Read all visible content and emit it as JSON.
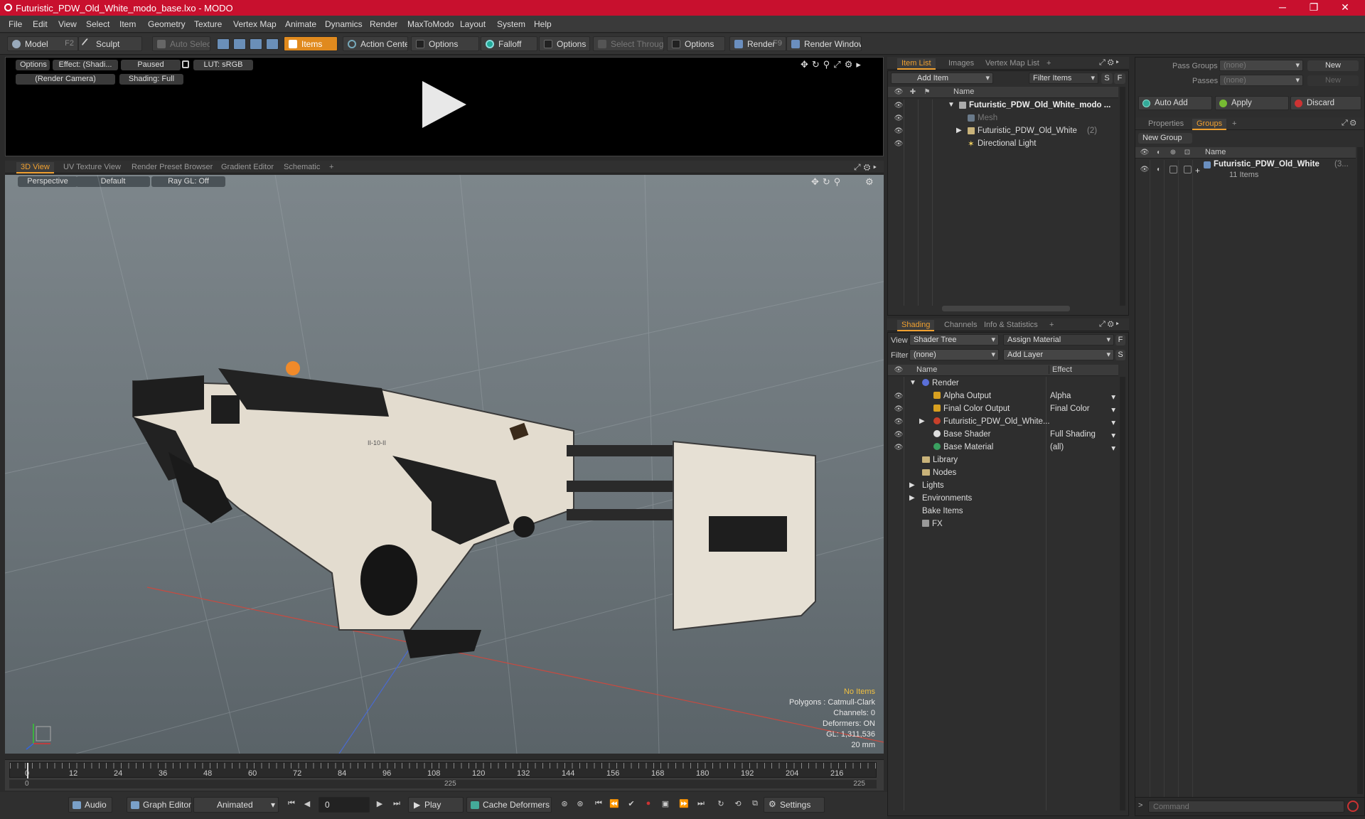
{
  "window": {
    "title": "Futuristic_PDW_Old_White_modo_base.lxo - MODO",
    "minimize": "─",
    "restore": "❐",
    "close": "✕"
  },
  "menu": [
    "File",
    "Edit",
    "View",
    "Select",
    "Item",
    "Geometry",
    "Texture",
    "Vertex Map",
    "Animate",
    "Dynamics",
    "Render",
    "MaxToModo",
    "Layout",
    "System",
    "Help"
  ],
  "toolbar": {
    "model": "Model",
    "model_key": "F2",
    "sculpt": "Sculpt",
    "auto_select": "Auto Select",
    "items": "Items",
    "action_center": "Action Center",
    "options1": "Options",
    "falloff": "Falloff",
    "options2": "Options",
    "select_through": "Select Through",
    "options3": "Options",
    "render": "Render",
    "render_key": "F9",
    "render_window": "Render Window"
  },
  "preview": {
    "options": "Options",
    "effect": "Effect: (Shadi...",
    "paused": "Paused",
    "lut": "LUT: sRGB",
    "camera": "(Render Camera)",
    "shading": "Shading: Full"
  },
  "viewport_tabs": [
    "3D View",
    "UV Texture View",
    "Render Preset Browser",
    "Gradient Editor",
    "Schematic",
    "+"
  ],
  "viewport": {
    "perspective": "Perspective",
    "default": "Default",
    "raygl": "Ray GL: Off",
    "hud": {
      "no_items": "No Items",
      "polygons": "Polygons : Catmull-Clark",
      "channels": "Channels: 0",
      "deformers": "Deformers: ON",
      "gl": "GL: 1,311,536",
      "scale": "20 mm"
    },
    "model_label": "II-10-II"
  },
  "timeline": {
    "ticks": [
      "0",
      "12",
      "24",
      "36",
      "48",
      "60",
      "72",
      "84",
      "96",
      "108",
      "120",
      "132",
      "144",
      "156",
      "168",
      "180",
      "192",
      "204",
      "216"
    ],
    "start": "0",
    "mid": "225",
    "end": "225"
  },
  "bottombar": {
    "audio": "Audio",
    "graph_editor": "Graph Editor",
    "animated": "Animated",
    "frame": "0",
    "play": "Play",
    "cache_deformers": "Cache Deformers",
    "settings": "Settings"
  },
  "itemlist": {
    "tabs": [
      "Item List",
      "Images",
      "Vertex Map List",
      "+"
    ],
    "add_item": "Add Item",
    "filter_items": "Filter Items",
    "s": "S",
    "f": "F",
    "col_name": "Name",
    "rows": [
      {
        "label": "Futuristic_PDW_Old_White_modo ...",
        "bold": true,
        "indent": 0
      },
      {
        "label": "Mesh",
        "dim": true,
        "indent": 1
      },
      {
        "label": "Futuristic_PDW_Old_White",
        "suffix": "(2)",
        "indent": 1
      },
      {
        "label": "Directional Light",
        "indent": 1
      }
    ]
  },
  "shading": {
    "tabs": [
      "Shading",
      "Channels",
      "Info & Statistics",
      "+"
    ],
    "view_label": "View",
    "view_value": "Shader Tree",
    "assign_material": "Assign Material",
    "f": "F",
    "filter_label": "Filter",
    "filter_value": "(none)",
    "add_layer": "Add Layer",
    "s": "S",
    "col_name": "Name",
    "col_effect": "Effect",
    "rows": [
      {
        "label": "Render",
        "effect": "",
        "indent": 0,
        "icon": "ball",
        "color": "#5a6fd8"
      },
      {
        "label": "Alpha Output",
        "effect": "Alpha",
        "indent": 1,
        "icon": "output"
      },
      {
        "label": "Final Color Output",
        "effect": "Final Color",
        "indent": 1,
        "icon": "output"
      },
      {
        "label": "Futuristic_PDW_Old_White...",
        "effect": "",
        "indent": 1,
        "icon": "ball",
        "color": "#c8402a"
      },
      {
        "label": "Base Shader",
        "effect": "Full Shading",
        "indent": 1,
        "icon": "ball",
        "color": "#dddddd"
      },
      {
        "label": "Base Material",
        "effect": "(all)",
        "indent": 1,
        "icon": "ball",
        "color": "#3aa060"
      },
      {
        "label": "Library",
        "effect": "",
        "indent": 0,
        "icon": "folder"
      },
      {
        "label": "Nodes",
        "effect": "",
        "indent": 0,
        "icon": "folder"
      },
      {
        "label": "Lights",
        "effect": "",
        "indent": -1,
        "icon": "none"
      },
      {
        "label": "Environments",
        "effect": "",
        "indent": -1,
        "icon": "none"
      },
      {
        "label": "Bake Items",
        "effect": "",
        "indent": -1,
        "icon": "none"
      },
      {
        "label": "FX",
        "effect": "",
        "indent": 0,
        "icon": "fx"
      }
    ]
  },
  "groups": {
    "pass_groups": "Pass Groups",
    "pass_groups_value": "(none)",
    "new": "New",
    "passes": "Passes",
    "passes_value": "(none)",
    "new2": "New",
    "auto_add": "Auto Add",
    "apply": "Apply",
    "discard": "Discard",
    "tabs": [
      "Properties",
      "Groups",
      "+"
    ],
    "new_group": "New Group",
    "col_name": "Name",
    "group_name": "Futuristic_PDW_Old_White",
    "group_suffix": "(3...",
    "group_count": "11 Items",
    "command_placeholder": "Command"
  },
  "colors": {
    "accent": "#f0a030",
    "title_bar": "#c8102e"
  }
}
